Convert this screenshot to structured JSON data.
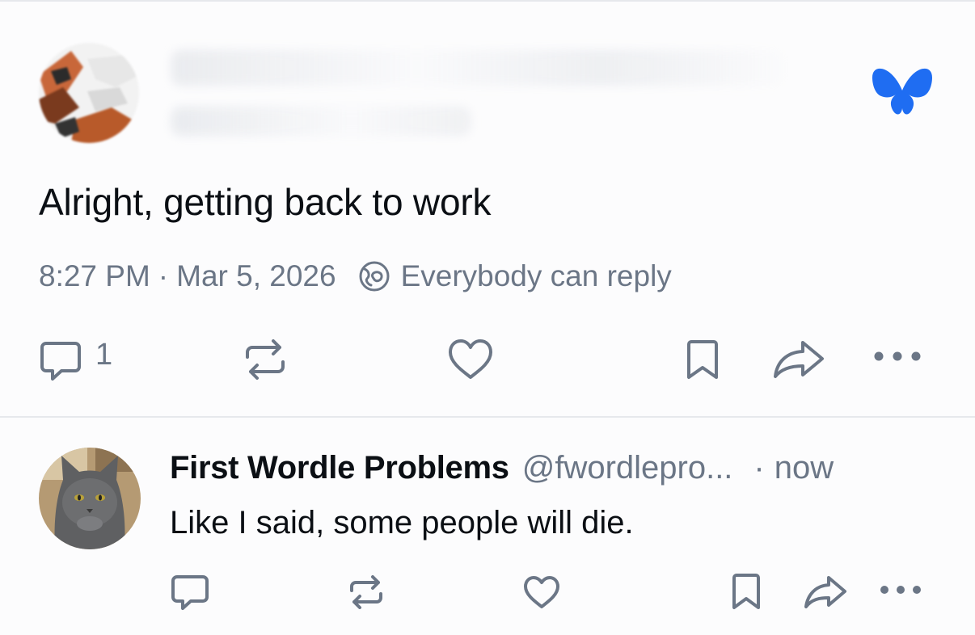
{
  "post": {
    "text": "Alright, getting back to work",
    "time": "8:27 PM",
    "date": "Mar 5, 2026",
    "reply_setting": "Everybody can reply",
    "reply_count": "1"
  },
  "reply": {
    "author_name": "First Wordle Problems",
    "author_handle": "@fwordlepro...",
    "time": "now",
    "text": "Like I said, some people will die."
  },
  "colors": {
    "text": "#0b0f14",
    "muted": "#6b7686",
    "brand": "#1f6df2",
    "divider": "#e6e8ec"
  },
  "icons": {
    "brand": "butterfly-icon",
    "reply": "speech-bubble-icon",
    "repost": "repost-arrows-icon",
    "like": "heart-icon",
    "bookmark": "bookmark-icon",
    "share": "share-arrow-icon",
    "more": "ellipsis-icon",
    "visibility": "globe-icon"
  }
}
